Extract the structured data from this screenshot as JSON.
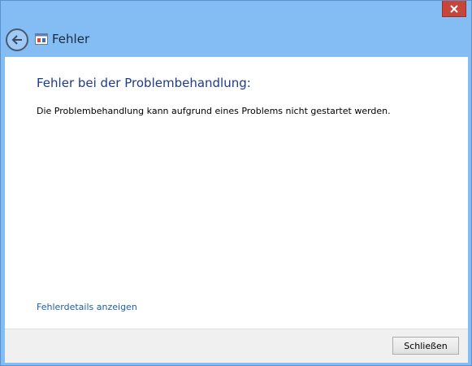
{
  "window": {
    "title": "Fehler",
    "close_glyph": "✕"
  },
  "content": {
    "heading": "Fehler bei der Problembehandlung:",
    "message": "Die Problembehandlung kann aufgrund eines Problems nicht gestartet werden.",
    "details_link": "Fehlerdetails anzeigen"
  },
  "footer": {
    "close_label": "Schließen"
  },
  "colors": {
    "titlebar": "#84bdf4",
    "close_button": "#c7463c",
    "heading": "#1e3a8a",
    "link": "#1d5fa8"
  },
  "icons": {
    "back": "back-arrow-icon",
    "app": "troubleshooter-icon",
    "close": "close-icon"
  }
}
